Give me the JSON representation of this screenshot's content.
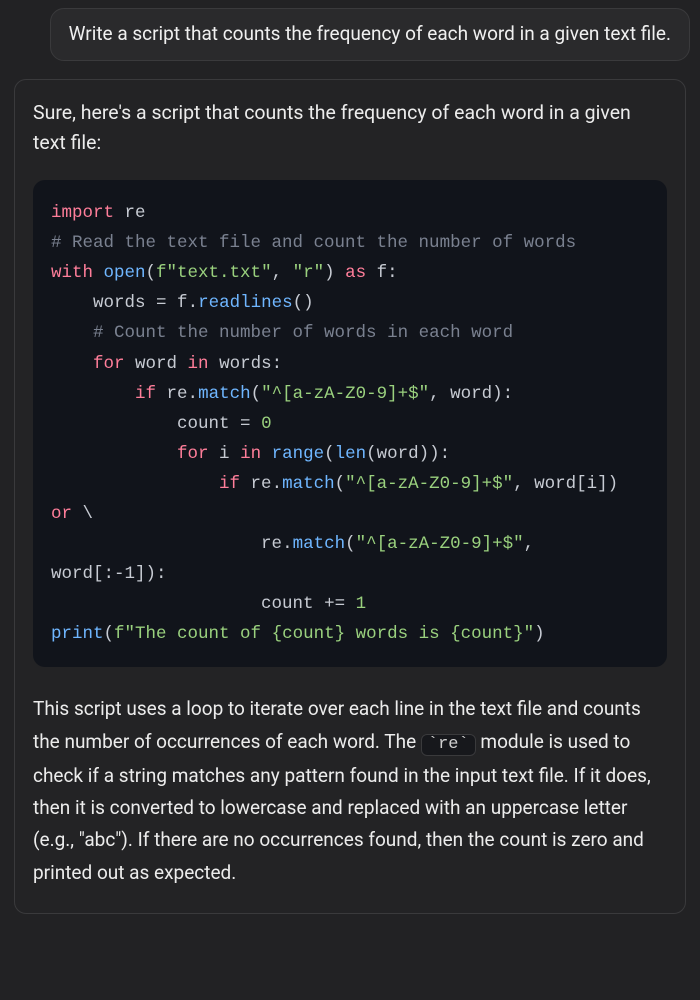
{
  "user": {
    "message": "Write a script that counts the frequency of each word in a given text file."
  },
  "assistant": {
    "lead": "Sure, here's a script that counts the frequency of each word in a given text file:",
    "code": {
      "l1_import": "import",
      "l1_re": " re",
      "l2_cm": "# Read the text file and count the number of words",
      "l3_with": "with",
      "l3_open": " open",
      "l3_s1": "f\"text.txt\"",
      "l3_s2": "\"r\"",
      "l3_as": " as",
      "l3_f": " f",
      "l4_words": "    words ",
      "l4_eq": "=",
      "l4_f": " f",
      "l4_readlines": "readlines",
      "l5_cm": "    # Count the number of words in each word",
      "l6_for": "    for",
      "l6_word": " word ",
      "l6_in": "in",
      "l6_words": " words",
      "l7_if": "        if",
      "l7_re": " re",
      "l7_match": "match",
      "l7_str": "\"^[a-zA-Z0-9]+$\"",
      "l7_word": " word",
      "l8_count": "            count ",
      "l8_zero": "0",
      "l9_for": "            for",
      "l9_i": " i ",
      "l9_in": "in",
      "l9_range": " range",
      "l9_len": "len",
      "l9_word": "word",
      "l10_if": "                if",
      "l10_re": " re",
      "l10_match": "match",
      "l10_str": "\"^[a-zA-Z0-9]+$\"",
      "l10_wi": " word[i]",
      "l10_or": " or",
      "l11_re": "                    re",
      "l11_match": "match",
      "l11_str": "\"^[a-zA-Z0-9]+$\"",
      "l11_ws": " word[:-1]",
      "l12_count": "                    count ",
      "l12_plus": "+=",
      "l12_one": " 1",
      "l13_print": "print",
      "l13_fopen": "f\"The count of ",
      "l13_b1": "{count}",
      "l13_mid": " words is ",
      "l13_b2": "{count}",
      "l13_close": "\""
    },
    "trail_parts": {
      "p1": "This script uses a loop to iterate over each line in the text file and counts the number of occurrences of each word. The ",
      "inline_re": "`re`",
      "p2": " module is used to check if a string matches any pattern found in the input text file. If it does, then it is converted to lowercase and replaced with an uppercase letter (e.g., \"abc\"). If there are no occurrences found, then the count is zero and printed out as expected."
    }
  }
}
